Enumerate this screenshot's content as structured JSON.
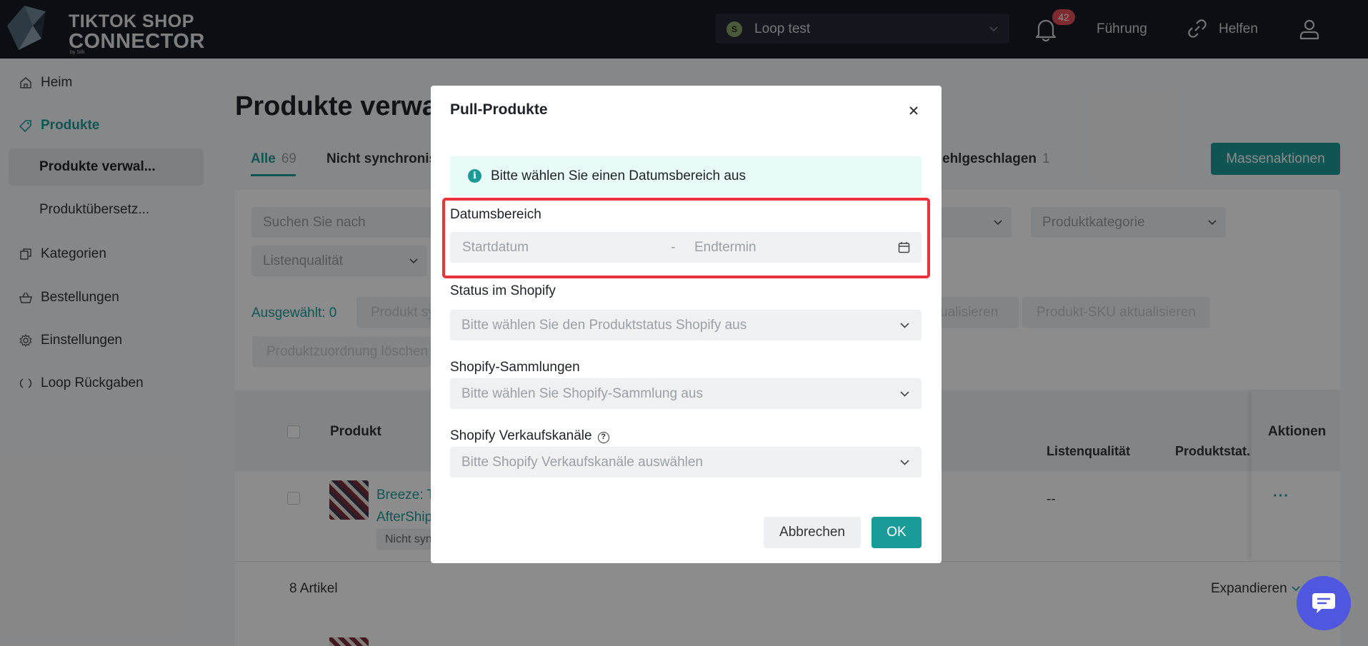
{
  "app": {
    "logo_line1": "TIKTOK SHOP",
    "logo_line2": "CONNECTOR",
    "logo_by": "by Silk"
  },
  "topbar": {
    "store_name": "Loop test",
    "notification_count": "42",
    "guide_label": "Führung",
    "help_label": "Helfen"
  },
  "sidebar": {
    "items": [
      {
        "label": "Heim",
        "icon": "home-icon"
      },
      {
        "label": "Produkte",
        "icon": "tag-icon"
      },
      {
        "label": "Produkte verwal...",
        "icon": ""
      },
      {
        "label": "Produktübersetz...",
        "icon": ""
      },
      {
        "label": "Kategorien",
        "icon": "copy-icon"
      },
      {
        "label": "Bestellungen",
        "icon": "basket-icon"
      },
      {
        "label": "Einstellungen",
        "icon": "gear-icon"
      },
      {
        "label": "Loop Rückgaben",
        "icon": "loop-icon"
      }
    ]
  },
  "main": {
    "page_title": "Produkte verwa",
    "tabs": [
      {
        "label": "Alle",
        "count": "69"
      },
      {
        "label": "Nicht synchronis",
        "count": ""
      }
    ],
    "tab_failed": {
      "label": "ehlgeschlagen",
      "count": "1"
    },
    "mass_actions_label": "Massenaktionen",
    "filters": {
      "search_placeholder": "Suchen Sie nach Produktnam",
      "category_placeholder": "Produktkategorie",
      "listing_quality_placeholder": "Listenqualität"
    },
    "selected_label": "Ausgewählt: 0",
    "bulk_buttons": [
      "Produkt sy",
      "ualisieren",
      "Produkt-SKU aktualisieren",
      "Produktzuordnung löschen"
    ],
    "table": {
      "columns": [
        "Produkt",
        "Listenqualität",
        "Produktstat.",
        "Aktionen"
      ],
      "row": {
        "name_line1": "Breeze: T",
        "name_line2": "AfterShip",
        "tag": "Nicht syn",
        "listing_quality": "--",
        "actions": "···"
      },
      "footer_count": "8 Artikel",
      "expand_label": "Expandieren"
    }
  },
  "modal": {
    "title": "Pull-Produkte",
    "info_text": "Bitte wählen Sie einen Datumsbereich aus",
    "date_range_label": "Datumsbereich",
    "start_placeholder": "Startdatum",
    "separator": "-",
    "end_placeholder": "Endtermin",
    "status_label": "Status im Shopify",
    "status_placeholder": "Bitte wählen Sie den Produktstatus Shopify aus",
    "collections_label": "Shopify-Sammlungen",
    "collections_placeholder": "Bitte wählen Sie Shopify-Sammlung aus",
    "channels_label": "Shopify Verkaufskanäle",
    "channels_placeholder": "Bitte Shopify Verkaufskanäle auswählen",
    "cancel_label": "Abbrechen",
    "ok_label": "OK"
  },
  "colors": {
    "accent": "#1a9b98",
    "topbar": "#141a24",
    "highlight_frame": "#e8323c",
    "chat": "#4f56e0"
  }
}
